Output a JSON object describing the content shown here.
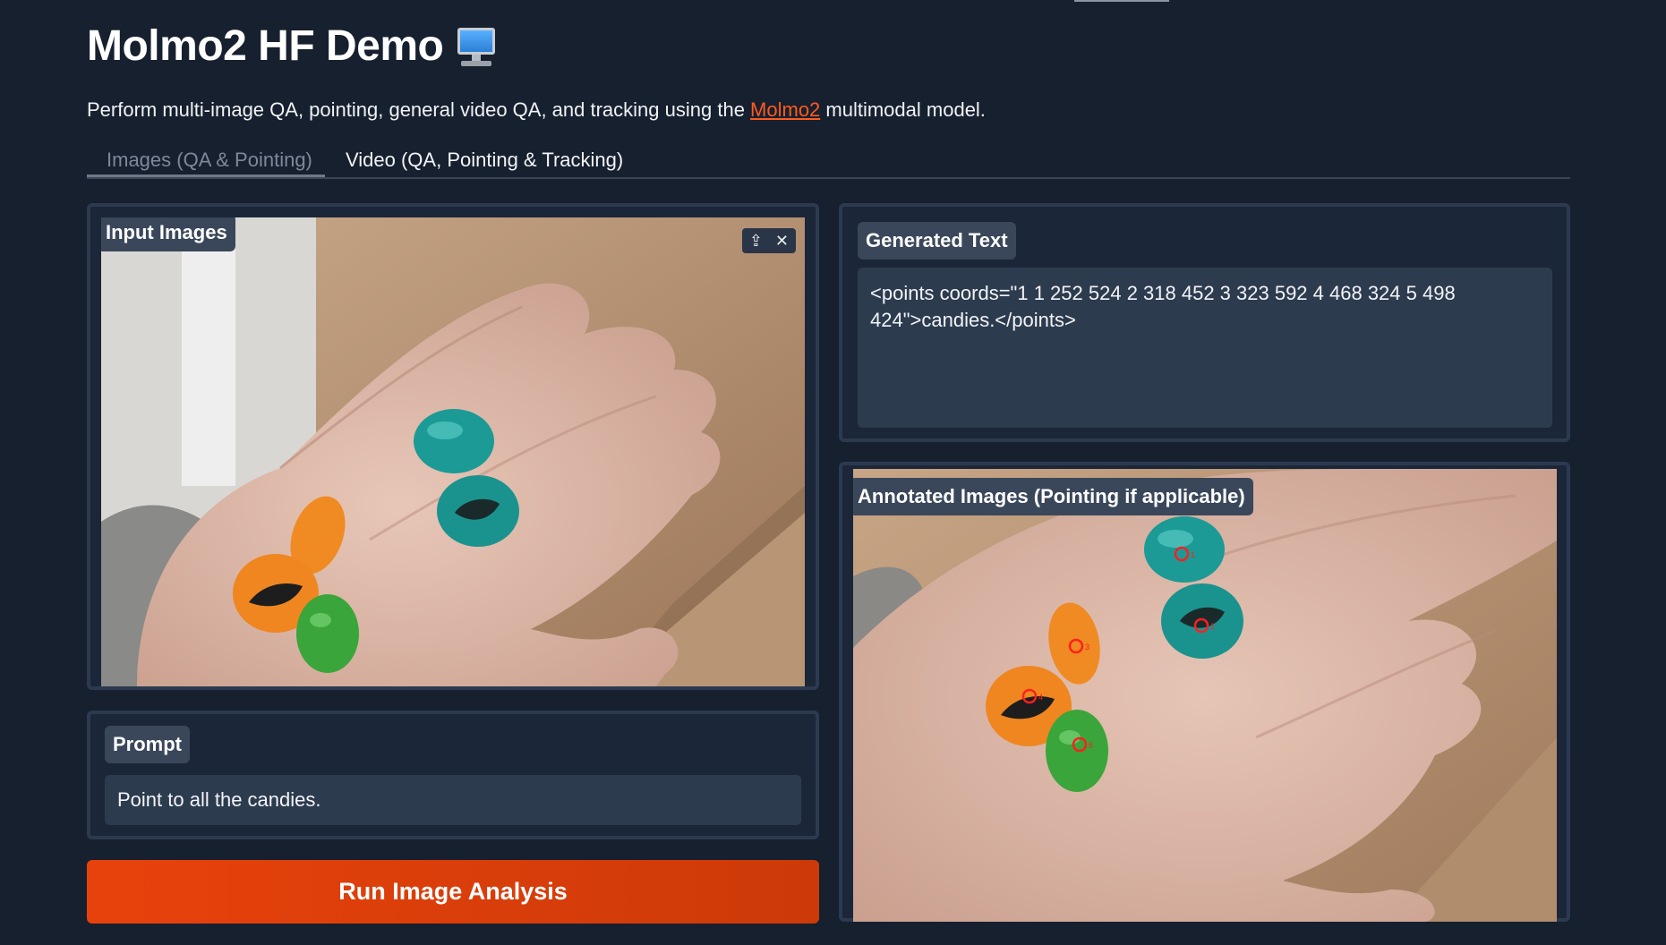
{
  "app": {
    "title": "Molmo2 HF Demo",
    "title_icon": "desktop-computer-icon",
    "subtitle_before": "Perform multi-image QA, pointing, general video QA, and tracking using the ",
    "subtitle_link": "Molmo2",
    "subtitle_after": " multimodal model."
  },
  "tabs": [
    {
      "label": "Images (QA & Pointing)",
      "selected": true
    },
    {
      "label": "Video (QA, Pointing & Tracking)",
      "selected": false
    }
  ],
  "input_images": {
    "label": "Input Images",
    "tools": [
      "upload-icon",
      "close-icon"
    ]
  },
  "prompt": {
    "label": "Prompt",
    "value": "Point to all the candies."
  },
  "run_button": {
    "label": "Run Image Analysis"
  },
  "generated_text": {
    "label": "Generated Text",
    "value": "<points coords=\"1 1 252 524 2 318 452 3 323 592 4 468 324 5 498 424\">candies.</points>"
  },
  "annotated_images": {
    "label": "Annotated Images (Pointing if applicable)"
  },
  "colors": {
    "background": "#16202f",
    "panel": "#1b2638",
    "accent": "#e8420c",
    "link": "#ff5a1f",
    "point_marker": "#ff1f1f"
  }
}
